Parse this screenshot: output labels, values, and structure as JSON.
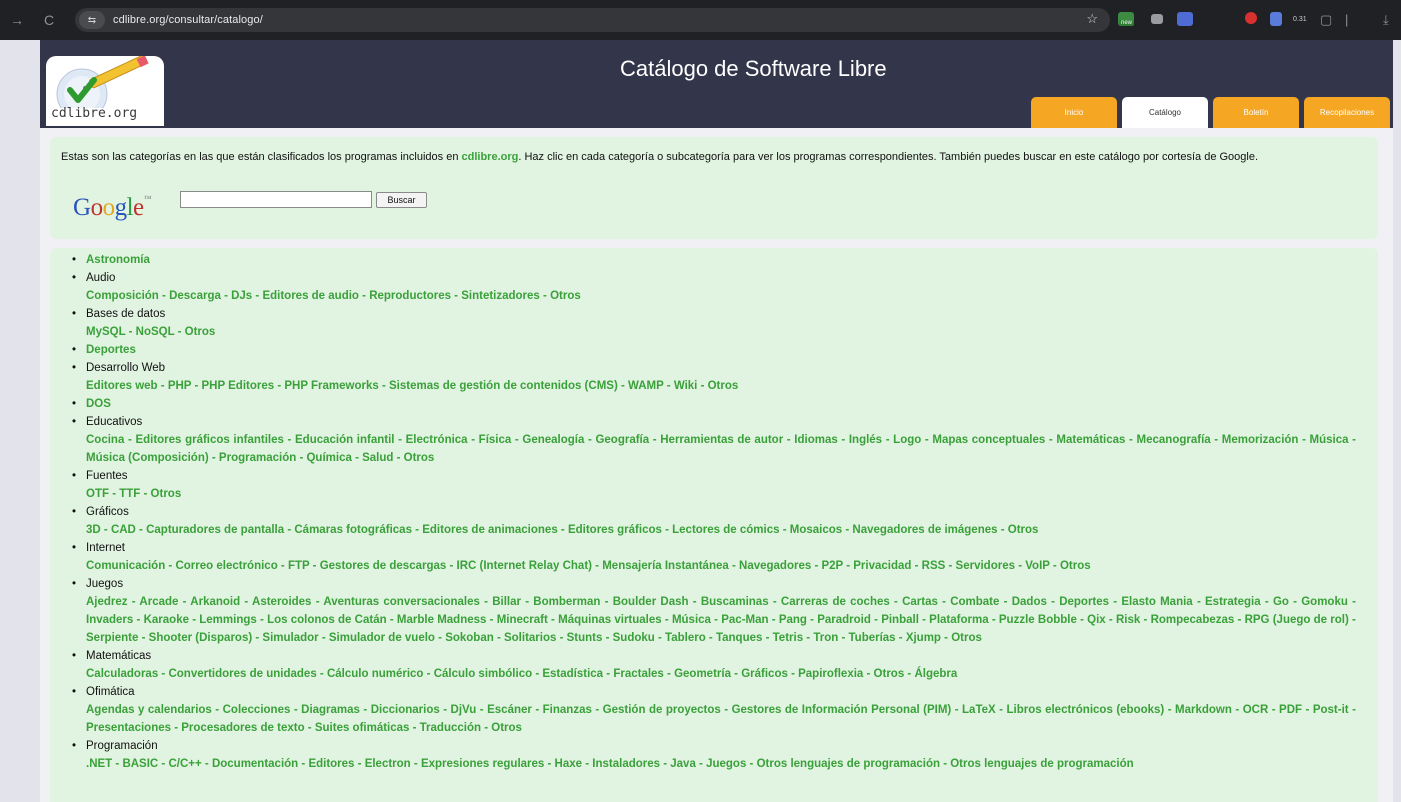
{
  "browser": {
    "url": "cdlibre.org/consultar/catalogo/",
    "site_info_glyph": "⇆",
    "back_glyph": "→",
    "reload_glyph": "C",
    "star_glyph": "☆",
    "ext_badge_text": "new",
    "ext_small_text": "0.31",
    "sidepanel_glyph": "▢",
    "more_glyph": "|",
    "download_glyph": "⤓"
  },
  "header": {
    "logo_text": "cdlibre.org",
    "title": "Catálogo de Software Libre",
    "tabs": [
      {
        "label": "Inicio"
      },
      {
        "label": "Catálogo"
      },
      {
        "label": "Boletín"
      },
      {
        "label": "Recopilaciones"
      }
    ]
  },
  "intro": {
    "text_before": "Estas son las categorías en las que están clasificados los programas incluidos en ",
    "site_link": "cdlibre.org",
    "text_after": ". Haz clic en cada categoría o subcategoría para ver los programas correspondientes. También puedes buscar en este catálogo por cortesía de Google.",
    "google_letters": [
      "G",
      "o",
      "o",
      "g",
      "l",
      "e"
    ],
    "google_tm": "™",
    "search_value": "",
    "search_button": "Buscar"
  },
  "categories": [
    {
      "name": "Astronomía",
      "is_link": true,
      "subs": []
    },
    {
      "name": "Audio",
      "is_link": false,
      "subs": [
        "Composición",
        "Descarga",
        "DJs",
        "Editores de audio",
        "Reproductores",
        "Sintetizadores",
        "Otros"
      ]
    },
    {
      "name": "Bases de datos",
      "is_link": false,
      "subs": [
        "MySQL",
        "NoSQL",
        "Otros"
      ]
    },
    {
      "name": "Deportes",
      "is_link": true,
      "subs": []
    },
    {
      "name": "Desarrollo Web",
      "is_link": false,
      "subs": [
        "Editores web",
        "PHP",
        "PHP Editores",
        "PHP Frameworks",
        "Sistemas de gestión de contenidos (CMS)",
        "WAMP",
        "Wiki",
        "Otros"
      ]
    },
    {
      "name": "DOS",
      "is_link": true,
      "subs": []
    },
    {
      "name": "Educativos",
      "is_link": false,
      "subs": [
        "Cocina",
        "Editores gráficos infantiles",
        "Educación infantil",
        "Electrónica",
        "Física",
        "Genealogía",
        "Geografía",
        "Herramientas de autor",
        "Idiomas",
        "Inglés",
        "Logo",
        "Mapas conceptuales",
        "Matemáticas",
        "Mecanografía",
        "Memorización",
        "Música",
        "Música (Composición)",
        "Programación",
        "Química",
        "Salud",
        "Otros"
      ]
    },
    {
      "name": "Fuentes",
      "is_link": false,
      "subs": [
        "OTF",
        "TTF",
        "Otros"
      ]
    },
    {
      "name": "Gráficos",
      "is_link": false,
      "subs": [
        "3D",
        "CAD",
        "Capturadores de pantalla",
        "Cámaras fotográficas",
        "Editores de animaciones",
        "Editores gráficos",
        "Lectores de cómics",
        "Mosaicos",
        "Navegadores de imágenes",
        "Otros"
      ]
    },
    {
      "name": "Internet",
      "is_link": false,
      "subs": [
        "Comunicación",
        "Correo electrónico",
        "FTP",
        "Gestores de descargas",
        "IRC (Internet Relay Chat)",
        "Mensajería Instantánea",
        "Navegadores",
        "P2P",
        "Privacidad",
        "RSS",
        "Servidores",
        "VoIP",
        "Otros"
      ]
    },
    {
      "name": "Juegos",
      "is_link": false,
      "subs": [
        "Ajedrez",
        "Arcade",
        "Arkanoid",
        "Asteroides",
        "Aventuras conversacionales",
        "Billar",
        "Bomberman",
        "Boulder Dash",
        "Buscaminas",
        "Carreras de coches",
        "Cartas",
        "Combate",
        "Dados",
        "Deportes",
        "Elasto Mania",
        "Estrategia",
        "Go",
        "Gomoku",
        "Invaders",
        "Karaoke",
        "Lemmings",
        "Los colonos de Catán",
        "Marble Madness",
        "Minecraft",
        "Máquinas virtuales",
        "Música",
        "Pac-Man",
        "Pang",
        "Paradroid",
        "Pinball",
        "Plataforma",
        "Puzzle Bobble",
        "Qix",
        "Risk",
        "Rompecabezas",
        "RPG (Juego de rol)",
        "Serpiente",
        "Shooter (Disparos)",
        "Simulador",
        "Simulador de vuelo",
        "Sokoban",
        "Solitarios",
        "Stunts",
        "Sudoku",
        "Tablero",
        "Tanques",
        "Tetris",
        "Tron",
        "Tuberías",
        "Xjump",
        "Otros"
      ]
    },
    {
      "name": "Matemáticas",
      "is_link": false,
      "subs": [
        "Calculadoras",
        "Convertidores de unidades",
        "Cálculo numérico",
        "Cálculo simbólico",
        "Estadística",
        "Fractales",
        "Geometría",
        "Gráficos",
        "Papiroflexia",
        "Otros",
        "Álgebra"
      ]
    },
    {
      "name": "Ofimática",
      "is_link": false,
      "subs": [
        "Agendas y calendarios",
        "Colecciones",
        "Diagramas",
        "Diccionarios",
        "DjVu",
        "Escáner",
        "Finanzas",
        "Gestión de proyectos",
        "Gestores de Información Personal (PIM)",
        "LaTeX",
        "Libros electrónicos (ebooks)",
        "Markdown",
        "OCR",
        "PDF",
        "Post-it",
        "Presentaciones",
        "Procesadores de texto",
        "Suites ofimáticas",
        "Traducción",
        "Otros"
      ]
    },
    {
      "name": "Programación",
      "is_link": false,
      "subs": [
        ".NET",
        "BASIC",
        "C/C++",
        "Documentación",
        "Editores",
        "Electron",
        "Expresiones regulares",
        "Haxe",
        "Instaladores",
        "Java",
        "Juegos",
        "Otros lenguajes de programación",
        "Otros lenguajes de programación"
      ]
    }
  ],
  "colors": {
    "link_green": "#3aa13a",
    "header_bg": "#33354a",
    "tab_orange": "#f5a623",
    "box_green": "#e1f3e1"
  }
}
